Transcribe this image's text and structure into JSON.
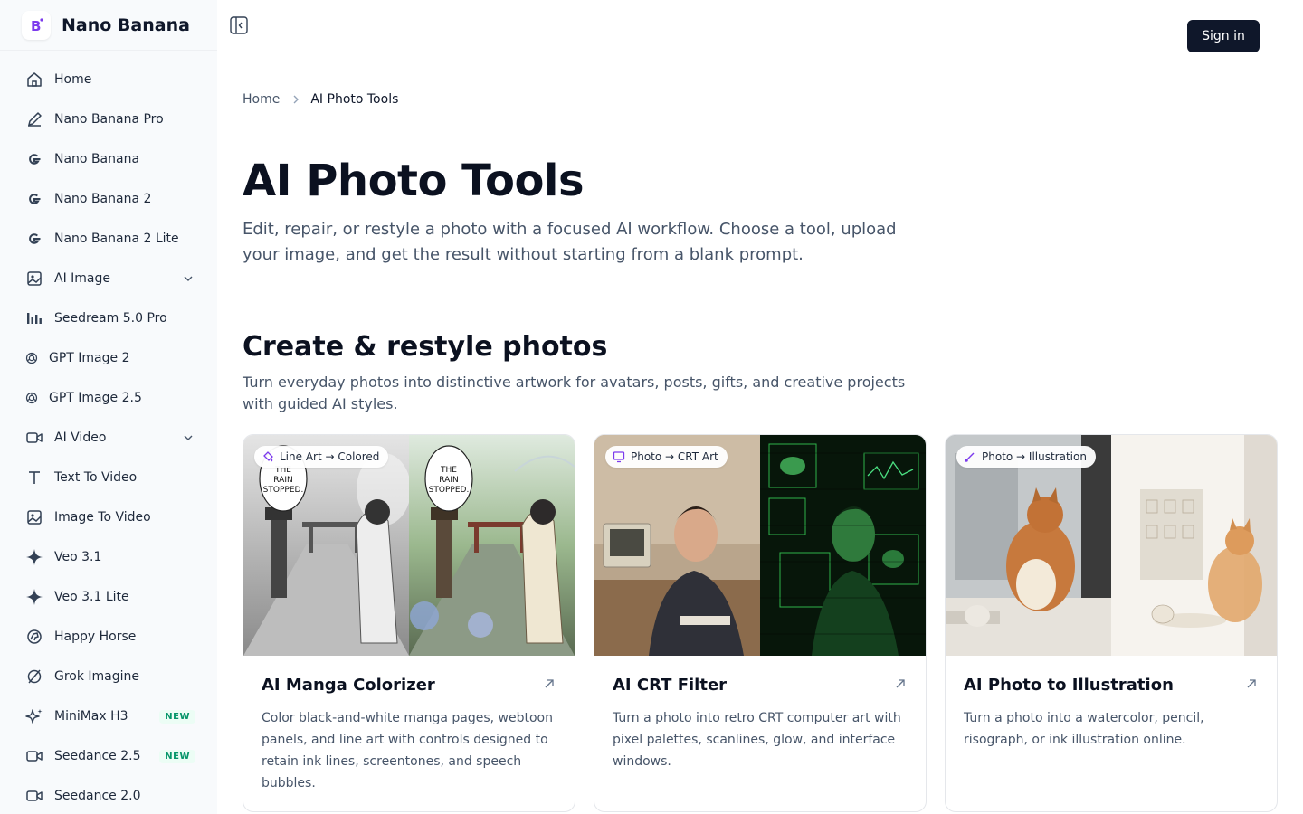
{
  "brand": {
    "title": "Nano Banana",
    "logo_letter": "B"
  },
  "sidebar": {
    "items": [
      {
        "label": "Home",
        "icon": "home-icon"
      },
      {
        "label": "Nano Banana Pro",
        "icon": "pen-icon"
      },
      {
        "label": "Nano Banana",
        "icon": "google-icon"
      },
      {
        "label": "Nano Banana 2",
        "icon": "google-icon"
      },
      {
        "label": "Nano Banana 2 Lite",
        "icon": "google-icon"
      },
      {
        "label": "AI Image",
        "icon": "image-icon",
        "expandable": true
      },
      {
        "label": "Seedream 5.0 Pro",
        "icon": "bar-chart-icon"
      },
      {
        "label": "GPT Image 2",
        "icon": "openai-icon"
      },
      {
        "label": "GPT Image 2.5",
        "icon": "openai-icon"
      },
      {
        "label": "AI Video",
        "icon": "video-icon",
        "expandable": true
      },
      {
        "label": "Text To Video",
        "icon": "text-icon"
      },
      {
        "label": "Image To Video",
        "icon": "image-icon"
      },
      {
        "label": "Veo 3.1",
        "icon": "sparkle-icon"
      },
      {
        "label": "Veo 3.1 Lite",
        "icon": "sparkle-icon"
      },
      {
        "label": "Happy Horse",
        "icon": "horse-icon"
      },
      {
        "label": "Grok Imagine",
        "icon": "grok-icon"
      },
      {
        "label": "MiniMax H3",
        "icon": "sparkles-icon",
        "badge": "NEW"
      },
      {
        "label": "Seedance 2.5",
        "icon": "video-icon",
        "badge": "NEW"
      },
      {
        "label": "Seedance 2.0",
        "icon": "video-icon"
      }
    ]
  },
  "header": {
    "signin_label": "Sign in"
  },
  "breadcrumb": {
    "home": "Home",
    "current": "AI Photo Tools"
  },
  "page": {
    "title": "AI Photo Tools",
    "subtitle": "Edit, repair, or restyle a photo with a focused AI workflow. Choose a tool, upload your image, and get the result without starting from a blank prompt."
  },
  "section": {
    "title": "Create & restyle photos",
    "description": "Turn everyday photos into distinctive artwork for avatars, posts, gifts, and creative projects with guided AI styles."
  },
  "cards": [
    {
      "tag": "Line Art → Colored",
      "tag_icon": "paint-bucket-icon",
      "title": "AI Manga Colorizer",
      "description": "Color black-and-white manga pages, webtoon panels, and line art with controls designed to retain ink lines, screentones, and speech bubbles.",
      "bubble_text": "THE RAIN STOPPED."
    },
    {
      "tag": "Photo → CRT Art",
      "tag_icon": "monitor-icon",
      "title": "AI CRT Filter",
      "description": "Turn a photo into retro CRT computer art with pixel palettes, scanlines, glow, and interface windows."
    },
    {
      "tag": "Photo → Illustration",
      "tag_icon": "brush-icon",
      "title": "AI Photo to Illustration",
      "description": "Turn a photo into a watercolor, pencil, risograph, or ink illustration online."
    }
  ],
  "colors": {
    "accent": "#7c3aed",
    "signin_bg": "#0f172a",
    "badge_green": "#059669",
    "sidebar_bg": "#f8fafc"
  }
}
